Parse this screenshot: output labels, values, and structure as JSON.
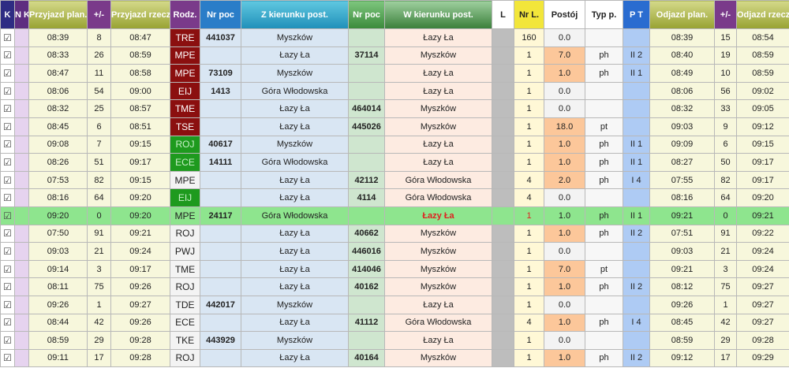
{
  "headers": {
    "k": "K",
    "nk": "N K",
    "arr_plan": "Przyjazd plan.",
    "delay_arr": "+/-",
    "arr_real": "Przyjazd rzecz.",
    "rodz": "Rodz.",
    "nr_poc": "Nr poc",
    "from": "Z kierunku post.",
    "nr_poc2": "Nr poc",
    "to": "W kierunku post.",
    "l": "L",
    "nr_l": "Nr L.",
    "postoj": "Postój",
    "typ": "Typ p.",
    "pt": "P T",
    "dep_plan": "Odjazd plan.",
    "delay_dep": "+/-",
    "dep_real": "Odjazd rzecz."
  },
  "colors": {
    "rodz_red": "#8b0f0f",
    "rodz_green": "#1e9a1e",
    "current_row": "#8ee58e",
    "postoj_hi": "#fcc79a"
  },
  "check_glyph": "☑",
  "rows": [
    {
      "arr_plan": "08:39",
      "d1": "8",
      "arr_real": "08:47",
      "rodz": "TRE",
      "rodz_style": "red",
      "nr": "441037",
      "from": "Myszków",
      "nr2": "",
      "to": "Łazy Ła",
      "nrl": "160",
      "postoj": "0.0",
      "post_hi": false,
      "typ": "",
      "pt": "",
      "dep_plan": "08:39",
      "d2": "15",
      "dep_real": "08:54"
    },
    {
      "arr_plan": "08:33",
      "d1": "26",
      "arr_real": "08:59",
      "rodz": "MPE",
      "rodz_style": "red",
      "nr": "",
      "from": "Łazy Ła",
      "nr2": "37114",
      "to": "Myszków",
      "nrl": "1",
      "postoj": "7.0",
      "post_hi": true,
      "typ": "ph",
      "pt": "II 2",
      "dep_plan": "08:40",
      "d2": "19",
      "dep_real": "08:59"
    },
    {
      "arr_plan": "08:47",
      "d1": "11",
      "arr_real": "08:58",
      "rodz": "MPE",
      "rodz_style": "red",
      "nr": "73109",
      "from": "Myszków",
      "nr2": "",
      "to": "Łazy Ła",
      "nrl": "1",
      "postoj": "1.0",
      "post_hi": true,
      "typ": "ph",
      "pt": "II 1",
      "dep_plan": "08:49",
      "d2": "10",
      "dep_real": "08:59"
    },
    {
      "arr_plan": "08:06",
      "d1": "54",
      "arr_real": "09:00",
      "rodz": "EIJ",
      "rodz_style": "red",
      "nr": "1413",
      "from": "Góra Włodowska",
      "nr2": "",
      "to": "Łazy Ła",
      "nrl": "1",
      "postoj": "0.0",
      "post_hi": false,
      "typ": "",
      "pt": "",
      "dep_plan": "08:06",
      "d2": "56",
      "dep_real": "09:02"
    },
    {
      "arr_plan": "08:32",
      "d1": "25",
      "arr_real": "08:57",
      "rodz": "TME",
      "rodz_style": "red",
      "nr": "",
      "from": "Łazy Ła",
      "nr2": "464014",
      "to": "Myszków",
      "nrl": "1",
      "postoj": "0.0",
      "post_hi": false,
      "typ": "",
      "pt": "",
      "dep_plan": "08:32",
      "d2": "33",
      "dep_real": "09:05"
    },
    {
      "arr_plan": "08:45",
      "d1": "6",
      "arr_real": "08:51",
      "rodz": "TSE",
      "rodz_style": "red",
      "nr": "",
      "from": "Łazy Ła",
      "nr2": "445026",
      "to": "Myszków",
      "nrl": "1",
      "postoj": "18.0",
      "post_hi": true,
      "typ": "pt",
      "pt": "",
      "dep_plan": "09:03",
      "d2": "9",
      "dep_real": "09:12"
    },
    {
      "arr_plan": "09:08",
      "d1": "7",
      "arr_real": "09:15",
      "rodz": "ROJ",
      "rodz_style": "green",
      "nr": "40617",
      "from": "Myszków",
      "nr2": "",
      "to": "Łazy Ła",
      "nrl": "1",
      "postoj": "1.0",
      "post_hi": true,
      "typ": "ph",
      "pt": "II 1",
      "dep_plan": "09:09",
      "d2": "6",
      "dep_real": "09:15"
    },
    {
      "arr_plan": "08:26",
      "d1": "51",
      "arr_real": "09:17",
      "rodz": "ECE",
      "rodz_style": "green",
      "nr": "14111",
      "from": "Góra Włodowska",
      "nr2": "",
      "to": "Łazy Ła",
      "nrl": "1",
      "postoj": "1.0",
      "post_hi": true,
      "typ": "ph",
      "pt": "II 1",
      "dep_plan": "08:27",
      "d2": "50",
      "dep_real": "09:17"
    },
    {
      "arr_plan": "07:53",
      "d1": "82",
      "arr_real": "09:15",
      "rodz": "MPE",
      "rodz_style": "white",
      "nr": "",
      "from": "Łazy Ła",
      "nr2": "42112",
      "to": "Góra Włodowska",
      "nrl": "4",
      "postoj": "2.0",
      "post_hi": true,
      "typ": "ph",
      "pt": "I 4",
      "dep_plan": "07:55",
      "d2": "82",
      "dep_real": "09:17"
    },
    {
      "arr_plan": "08:16",
      "d1": "64",
      "arr_real": "09:20",
      "rodz": "EIJ",
      "rodz_style": "green",
      "nr": "",
      "from": "Łazy Ła",
      "nr2": "4114",
      "to": "Góra Włodowska",
      "nrl": "4",
      "postoj": "0.0",
      "post_hi": false,
      "typ": "",
      "pt": "",
      "dep_plan": "08:16",
      "d2": "64",
      "dep_real": "09:20"
    },
    {
      "arr_plan": "09:20",
      "d1": "0",
      "arr_real": "09:20",
      "rodz": "MPE",
      "rodz_style": "current",
      "nr": "24117",
      "from": "Góra Włodowska",
      "nr2": "",
      "to": "Łazy Ła",
      "nrl": "1",
      "postoj": "1.0",
      "post_hi": true,
      "typ": "ph",
      "pt": "II 1",
      "dep_plan": "09:21",
      "d2": "0",
      "dep_real": "09:21",
      "current": true
    },
    {
      "arr_plan": "07:50",
      "d1": "91",
      "arr_real": "09:21",
      "rodz": "ROJ",
      "rodz_style": "white",
      "nr": "",
      "from": "Łazy Ła",
      "nr2": "40662",
      "to": "Myszków",
      "nrl": "1",
      "postoj": "1.0",
      "post_hi": true,
      "typ": "ph",
      "pt": "II 2",
      "dep_plan": "07:51",
      "d2": "91",
      "dep_real": "09:22"
    },
    {
      "arr_plan": "09:03",
      "d1": "21",
      "arr_real": "09:24",
      "rodz": "PWJ",
      "rodz_style": "white",
      "nr": "",
      "from": "Łazy Ła",
      "nr2": "446016",
      "to": "Myszków",
      "nrl": "1",
      "postoj": "0.0",
      "post_hi": false,
      "typ": "",
      "pt": "",
      "dep_plan": "09:03",
      "d2": "21",
      "dep_real": "09:24"
    },
    {
      "arr_plan": "09:14",
      "d1": "3",
      "arr_real": "09:17",
      "rodz": "TME",
      "rodz_style": "white",
      "nr": "",
      "from": "Łazy Ła",
      "nr2": "414046",
      "to": "Myszków",
      "nrl": "1",
      "postoj": "7.0",
      "post_hi": true,
      "typ": "pt",
      "pt": "",
      "dep_plan": "09:21",
      "d2": "3",
      "dep_real": "09:24"
    },
    {
      "arr_plan": "08:11",
      "d1": "75",
      "arr_real": "09:26",
      "rodz": "ROJ",
      "rodz_style": "white",
      "nr": "",
      "from": "Łazy Ła",
      "nr2": "40162",
      "to": "Myszków",
      "nrl": "1",
      "postoj": "1.0",
      "post_hi": true,
      "typ": "ph",
      "pt": "II 2",
      "dep_plan": "08:12",
      "d2": "75",
      "dep_real": "09:27"
    },
    {
      "arr_plan": "09:26",
      "d1": "1",
      "arr_real": "09:27",
      "rodz": "TDE",
      "rodz_style": "white",
      "nr": "442017",
      "from": "Myszków",
      "nr2": "",
      "to": "Łazy Ła",
      "nrl": "1",
      "postoj": "0.0",
      "post_hi": false,
      "typ": "",
      "pt": "",
      "dep_plan": "09:26",
      "d2": "1",
      "dep_real": "09:27"
    },
    {
      "arr_plan": "08:44",
      "d1": "42",
      "arr_real": "09:26",
      "rodz": "ECE",
      "rodz_style": "white",
      "nr": "",
      "from": "Łazy Ła",
      "nr2": "41112",
      "to": "Góra Włodowska",
      "nrl": "4",
      "postoj": "1.0",
      "post_hi": true,
      "typ": "ph",
      "pt": "I 4",
      "dep_plan": "08:45",
      "d2": "42",
      "dep_real": "09:27"
    },
    {
      "arr_plan": "08:59",
      "d1": "29",
      "arr_real": "09:28",
      "rodz": "TKE",
      "rodz_style": "white",
      "nr": "443929",
      "from": "Myszków",
      "nr2": "",
      "to": "Łazy Ła",
      "nrl": "1",
      "postoj": "0.0",
      "post_hi": false,
      "typ": "",
      "pt": "",
      "dep_plan": "08:59",
      "d2": "29",
      "dep_real": "09:28"
    },
    {
      "arr_plan": "09:11",
      "d1": "17",
      "arr_real": "09:28",
      "rodz": "ROJ",
      "rodz_style": "white",
      "nr": "",
      "from": "Łazy Ła",
      "nr2": "40164",
      "to": "Myszków",
      "nrl": "1",
      "postoj": "1.0",
      "post_hi": true,
      "typ": "ph",
      "pt": "II 2",
      "dep_plan": "09:12",
      "d2": "17",
      "dep_real": "09:29"
    }
  ]
}
